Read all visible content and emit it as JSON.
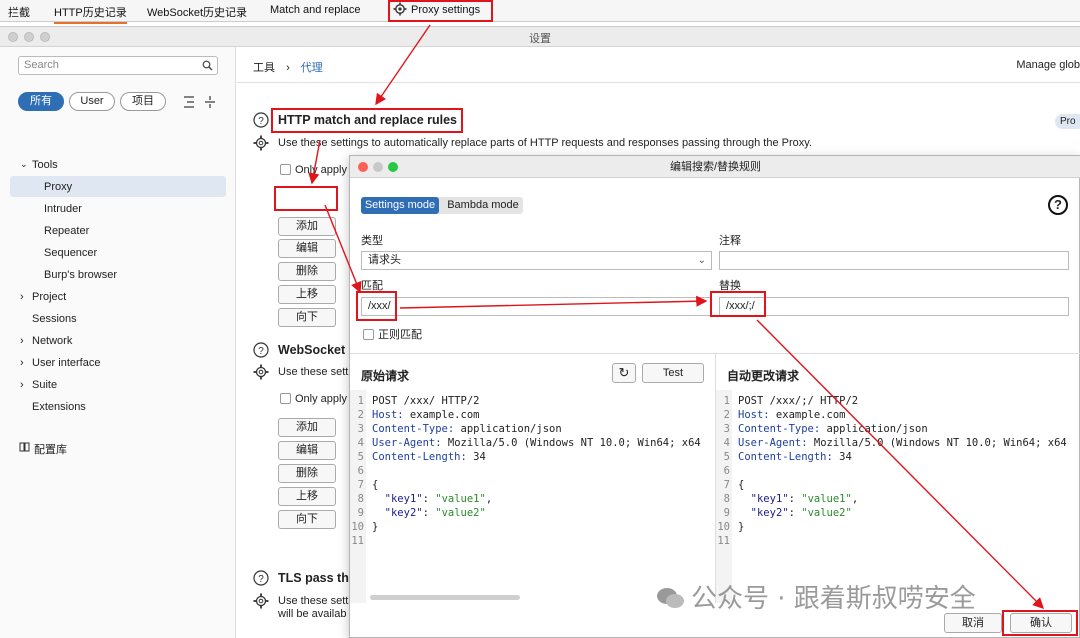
{
  "top_tabs": [
    "拦截",
    "HTTP历史记录",
    "WebSocket历史记录",
    "Match and replace",
    "Proxy settings"
  ],
  "window_title": "设置",
  "sidebar": {
    "search_placeholder": "Search",
    "filters": [
      "所有",
      "User",
      "项目"
    ],
    "items": [
      {
        "label": "Tools",
        "expanded": true
      },
      {
        "label": "Proxy",
        "selected": true
      },
      {
        "label": "Intruder"
      },
      {
        "label": "Repeater"
      },
      {
        "label": "Sequencer"
      },
      {
        "label": "Burp's browser"
      },
      {
        "label": "Project"
      },
      {
        "label": "Sessions"
      },
      {
        "label": "Network"
      },
      {
        "label": "User interface"
      },
      {
        "label": "Suite"
      },
      {
        "label": "Extensions"
      }
    ],
    "library": "配置库"
  },
  "main": {
    "breadcrumb_root": "工具",
    "breadcrumb_sep": "›",
    "breadcrumb_leaf": "代理",
    "manage": "Manage glob",
    "badge": "Pro",
    "http_section": {
      "title": "HTTP match and replace rules",
      "description": "Use these settings to automatically replace parts of HTTP requests and responses passing through the Proxy.",
      "only_apply": "Only apply",
      "buttons": [
        "添加",
        "编辑",
        "删除",
        "上移",
        "向下"
      ]
    },
    "ws_section": {
      "title": "WebSocket",
      "description": "Use these sett",
      "only_apply": "Only apply",
      "buttons": [
        "添加",
        "编辑",
        "删除",
        "上移",
        "向下"
      ]
    },
    "tls_section": {
      "title": "TLS pass thr",
      "description_1": "Use these sett",
      "description_2": "will be availab"
    }
  },
  "dialog": {
    "title": "编辑搜索/替换规则",
    "modes": [
      "Settings mode",
      "Bambda mode"
    ],
    "help": "?",
    "type_label": "类型",
    "type_value": "请求头",
    "comment_label": "注释",
    "comment_value": "",
    "match_label": "匹配",
    "match_value": "/xxx/",
    "replace_label": "替换",
    "replace_value": "/xxx/;/",
    "regex_label": "正则匹配",
    "original_title": "原始请求",
    "test_label": "Test",
    "auto_title": "自动更改请求",
    "cancel": "取消",
    "confirm": "确认"
  },
  "original_request": [
    {
      "n": "1",
      "text": "POST /xxx/ HTTP/2"
    },
    {
      "n": "2",
      "key": "Host:",
      "val": " example.com"
    },
    {
      "n": "3",
      "key": "Content-Type:",
      "val": " application/json"
    },
    {
      "n": "4",
      "key": "User-Agent:",
      "val": " Mozilla/5.0 (Windows NT 10.0; Win64; x64"
    },
    {
      "n": "5",
      "key": "Content-Length:",
      "val": " 34"
    },
    {
      "n": "6",
      "text": ""
    },
    {
      "n": "7",
      "text": "{"
    },
    {
      "n": "8",
      "jk": "\"key1\"",
      "jv": "\"value1\"",
      "end": ","
    },
    {
      "n": "9",
      "jk": "\"key2\"",
      "jv": "\"value2\"",
      "end": ""
    },
    {
      "n": "10",
      "text": "}"
    },
    {
      "n": "11",
      "text": ""
    }
  ],
  "modified_request": [
    {
      "n": "1",
      "text": "POST /xxx/;/ HTTP/2"
    },
    {
      "n": "2",
      "key": "Host:",
      "val": " example.com"
    },
    {
      "n": "3",
      "key": "Content-Type:",
      "val": " application/json"
    },
    {
      "n": "4",
      "key": "User-Agent:",
      "val": " Mozilla/5.0 (Windows NT 10.0; Win64; x64"
    },
    {
      "n": "5",
      "key": "Content-Length:",
      "val": " 34"
    },
    {
      "n": "6",
      "text": ""
    },
    {
      "n": "7",
      "text": "{"
    },
    {
      "n": "8",
      "jk": "\"key1\"",
      "jv": "\"value1\"",
      "end": ","
    },
    {
      "n": "9",
      "jk": "\"key2\"",
      "jv": "\"value2\"",
      "end": ""
    },
    {
      "n": "10",
      "text": "}"
    },
    {
      "n": "11",
      "text": ""
    }
  ],
  "watermark": "公众号 · 跟着斯叔唠安全",
  "colors": {
    "accent": "#2f6db5",
    "annotation": "#e0141b",
    "selection": "#dfe7f2"
  }
}
